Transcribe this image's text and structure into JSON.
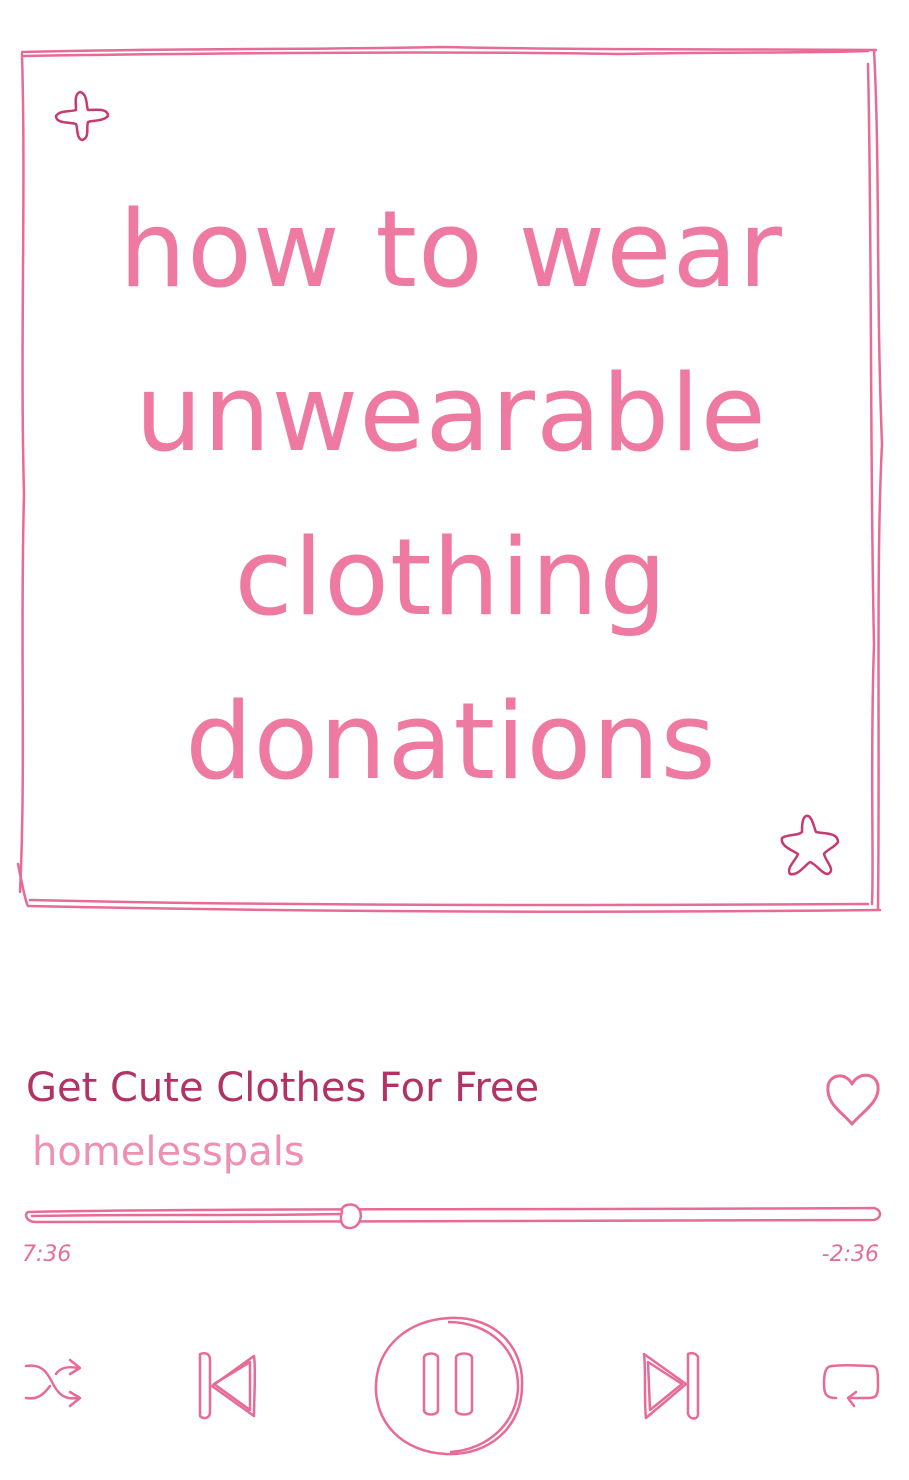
{
  "artwork": {
    "lines": [
      "how to wear",
      "unwearable",
      "clothing",
      "donations"
    ]
  },
  "track": {
    "title": "Get Cute Clothes For Free",
    "artist": "homelesspals"
  },
  "playback": {
    "elapsed": "7:36",
    "remaining": "-2:36",
    "progress_fraction": 0.38,
    "state": "playing"
  },
  "controls": [
    "shuffle",
    "previous",
    "pause",
    "next",
    "repeat"
  ],
  "icons": [
    "sparkle-icon",
    "star-icon",
    "heart-icon",
    "shuffle-icon",
    "previous-icon",
    "pause-icon",
    "next-icon",
    "repeat-icon"
  ],
  "colors": {
    "accent": "#ef7aa1",
    "title": "#b23265",
    "subtitle": "#ef8fb2",
    "stroke": "#e86a96"
  }
}
